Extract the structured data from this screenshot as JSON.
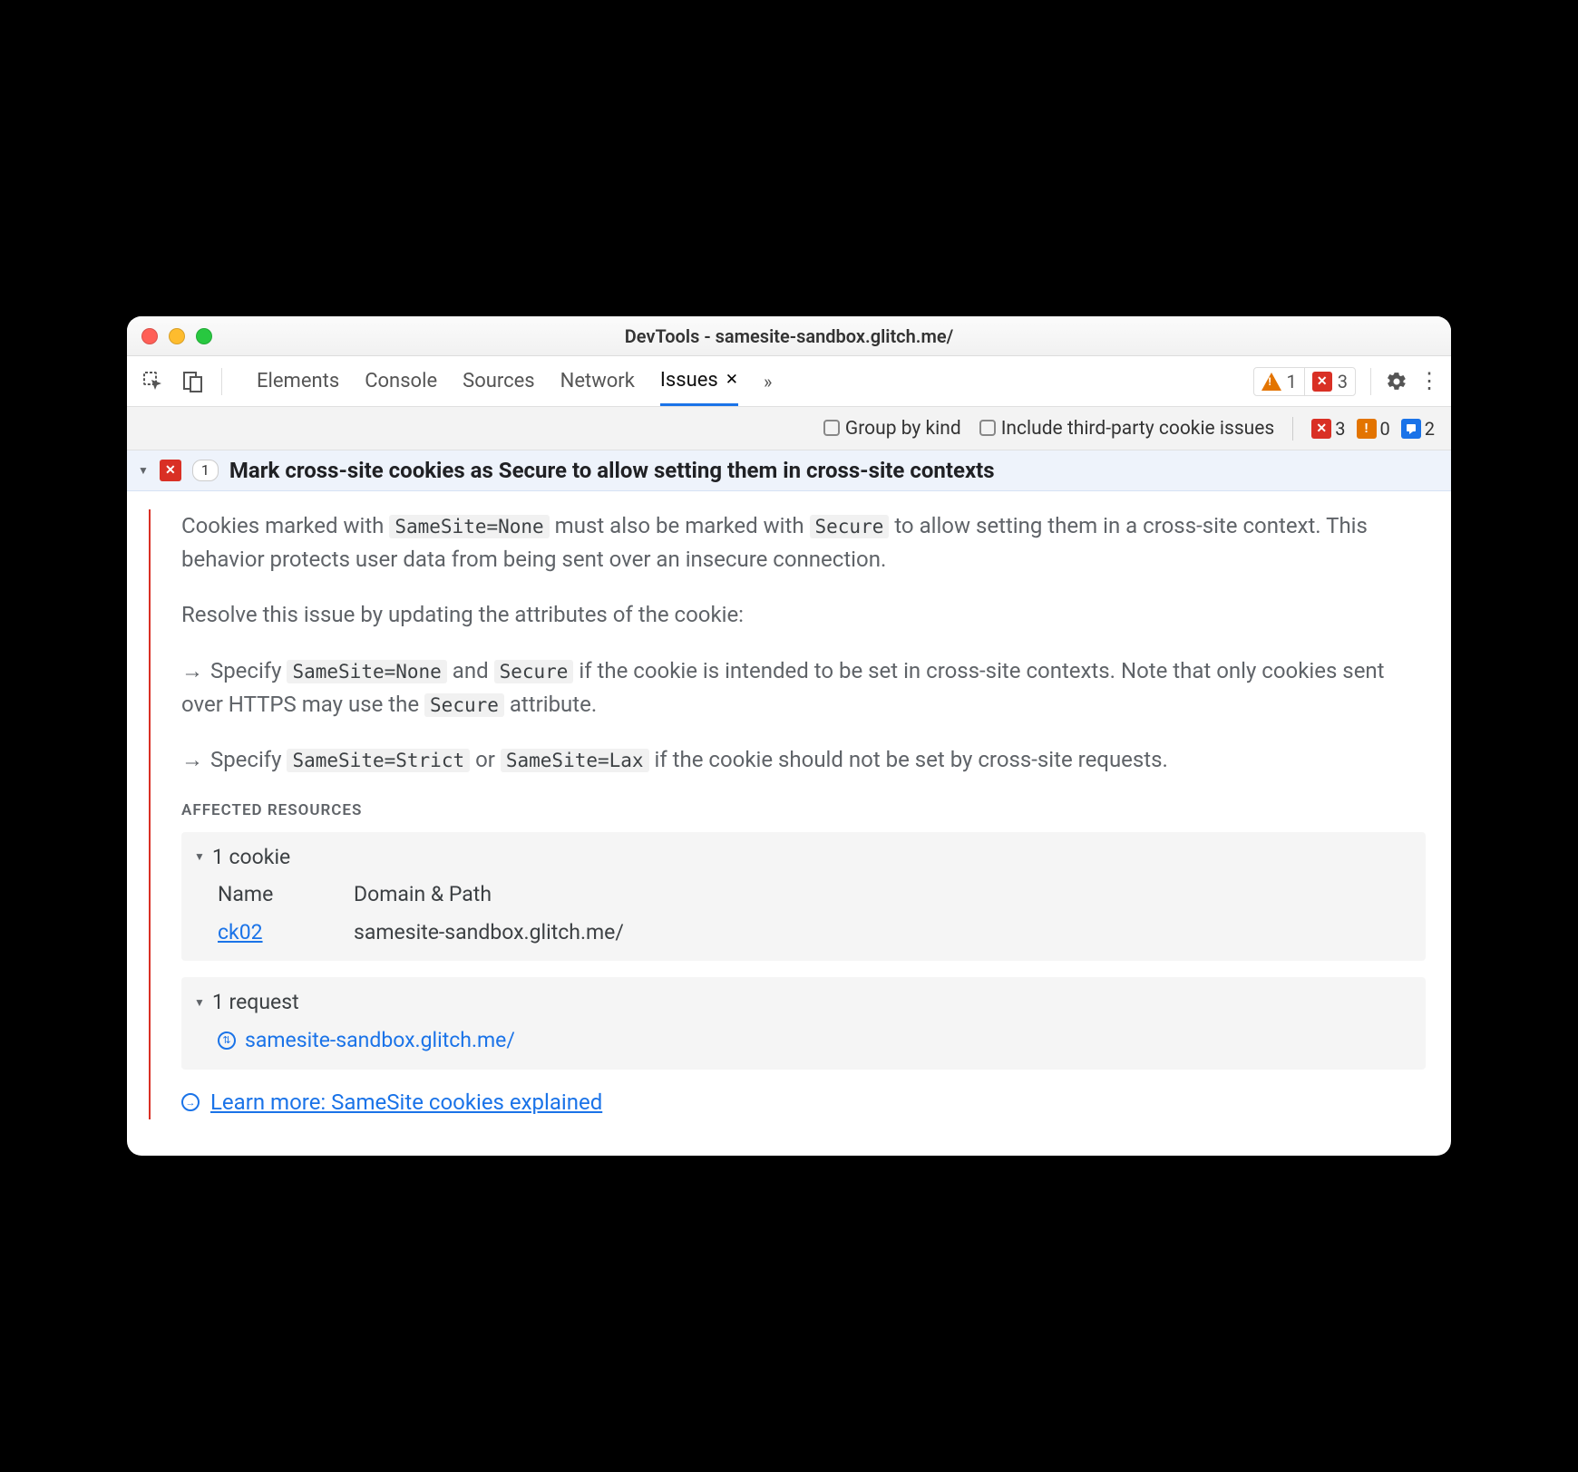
{
  "window": {
    "title": "DevTools - samesite-sandbox.glitch.me/"
  },
  "tabs": {
    "list": [
      "Elements",
      "Console",
      "Sources",
      "Network"
    ],
    "active": "Issues"
  },
  "toolbar_status": {
    "warning_count": "1",
    "error_count": "3"
  },
  "filter": {
    "group_label": "Group by kind",
    "include_label": "Include third-party cookie issues",
    "err": "3",
    "warn": "0",
    "info": "2"
  },
  "issue": {
    "count": "1",
    "title": "Mark cross-site cookies as Secure to allow setting them in cross-site contexts",
    "p1_a": "Cookies marked with ",
    "p1_code1": "SameSite=None",
    "p1_b": " must also be marked with ",
    "p1_code2": "Secure",
    "p1_c": " to allow setting them in a cross-site context. This behavior protects user data from being sent over an insecure connection.",
    "p2": "Resolve this issue by updating the attributes of the cookie:",
    "b1_a": "Specify ",
    "b1_code1": "SameSite=None",
    "b1_b": " and ",
    "b1_code2": "Secure",
    "b1_c": " if the cookie is intended to be set in cross-site contexts. Note that only cookies sent over HTTPS may use the ",
    "b1_code3": "Secure",
    "b1_d": " attribute.",
    "b2_a": "Specify ",
    "b2_code1": "SameSite=Strict",
    "b2_b": " or ",
    "b2_code2": "SameSite=Lax",
    "b2_c": " if the cookie should not be set by cross-site requests."
  },
  "affected": {
    "label": "Affected Resources",
    "cookie_head": "1 cookie",
    "col_name": "Name",
    "col_domain": "Domain & Path",
    "cookie_name": "ck02",
    "cookie_domain": "samesite-sandbox.glitch.me/",
    "request_head": "1 request",
    "request_url": "samesite-sandbox.glitch.me/"
  },
  "learn": "Learn more: SameSite cookies explained"
}
